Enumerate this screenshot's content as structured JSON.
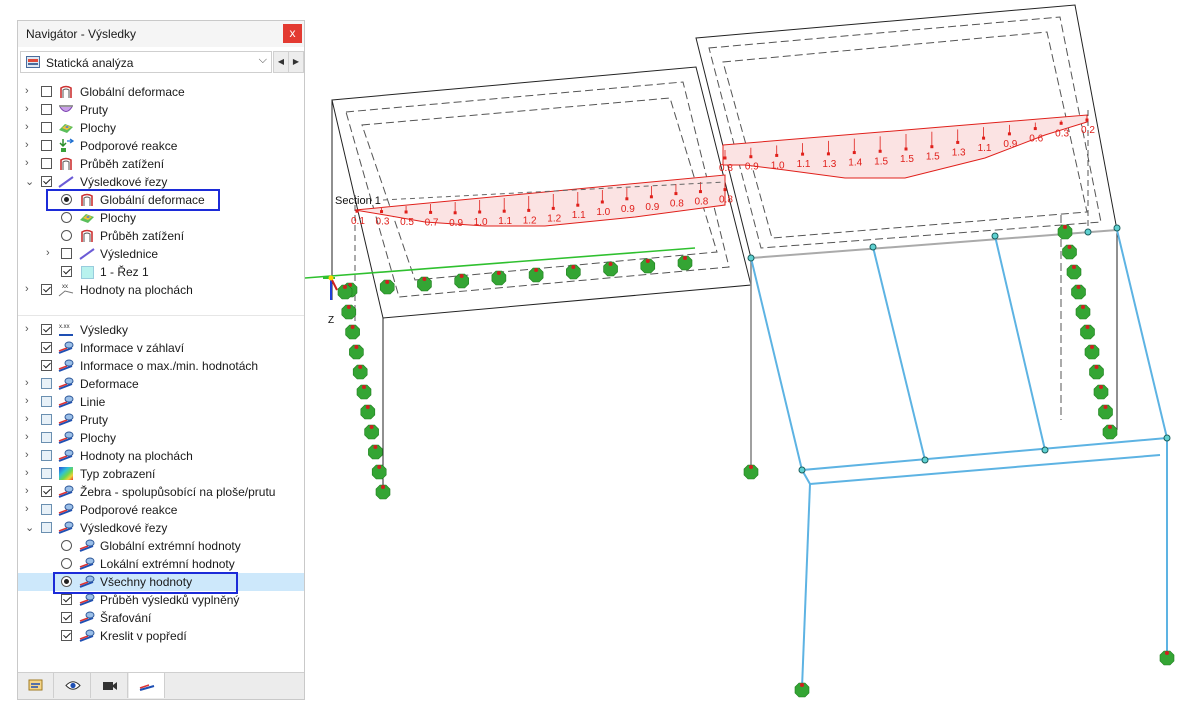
{
  "window": {
    "title": "Navigátor - Výsledky",
    "close": "x"
  },
  "combo": {
    "selected": "Statická analýza",
    "chevron": "⌵"
  },
  "nav": {
    "prev": "◀",
    "next": "▶"
  },
  "tree1": {
    "global_deformace": "Globální deformace",
    "pruty": "Pruty",
    "plochy": "Plochy",
    "podporove_reakce": "Podporové reakce",
    "prubeh_zatizeni": "Průběh zatížení",
    "vysledkove_rezy": "Výsledkové řezy",
    "sub_global_deformace": "Globální deformace",
    "sub_plochy": "Plochy",
    "sub_prubeh_zatizeni": "Průběh zatížení",
    "sub_vyslednice": "Výslednice",
    "rez_1": "1 - Řez 1",
    "hodnoty_na_plochach": "Hodnoty na plochách"
  },
  "tree2": {
    "vysledky": "Výsledky",
    "informace_v_zahlavi": "Informace v záhlaví",
    "informace_max_min": "Informace o max./min. hodnotách",
    "deformace": "Deformace",
    "linie": "Linie",
    "pruty": "Pruty",
    "plochy": "Plochy",
    "hodnoty_na_plochach": "Hodnoty na plochách",
    "typ_zobrazeni": "Typ zobrazení",
    "zebra": "Žebra - spolupůsobící na ploše/prutu",
    "podporove_reakce": "Podporové reakce",
    "vysledkove_rezy": "Výsledkové řezy",
    "globalni_extremni": "Globální extrémní hodnoty",
    "lokalni_extremni": "Lokální extrémní hodnoty",
    "vsechny_hodnoty": "Všechny hodnoty",
    "prubeh_vysledku": "Průběh výsledků vyplněný",
    "srafovani": "Šrafování",
    "kreslit_v_popredi": "Kreslit v popředí"
  },
  "viewport": {
    "section_label": "Section 1",
    "axis_z": "Z",
    "left_values": [
      "0.1",
      "0.3",
      "0.5",
      "0.7",
      "0.9",
      "1.0",
      "1.1",
      "1.2",
      "1.2",
      "1.1",
      "1.0",
      "0.9",
      "0.9",
      "0.8",
      "0.8",
      "0.8"
    ],
    "right_values": [
      "0.8",
      "0.9",
      "1.0",
      "1.1",
      "1.3",
      "1.4",
      "1.5",
      "1.5",
      "1.5",
      "1.3",
      "1.1",
      "0.9",
      "0.6",
      "0.3",
      "0.2"
    ],
    "colors": {
      "result": "#e0201b",
      "fill": "#fbe3e3",
      "support": "#34a534",
      "member": "#5db3e3",
      "node": "#2aa3a3"
    }
  }
}
